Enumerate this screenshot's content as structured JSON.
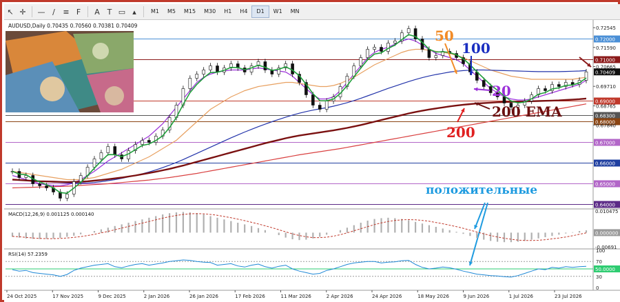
{
  "toolbar": {
    "timeframes": [
      {
        "label": "M1",
        "active": false
      },
      {
        "label": "M5",
        "active": false
      },
      {
        "label": "M15",
        "active": false
      },
      {
        "label": "M30",
        "active": false
      },
      {
        "label": "H1",
        "active": false
      },
      {
        "label": "H4",
        "active": false
      },
      {
        "label": "D1",
        "active": true
      },
      {
        "label": "W1",
        "active": false
      },
      {
        "label": "MN",
        "active": false
      }
    ],
    "tools": [
      "cursor-icon",
      "crosshair-icon",
      "horizontal-line-icon",
      "trendline-icon",
      "channel-icon",
      "fibonacci-icon",
      "text-icon",
      "label-icon",
      "rectangle-icon",
      "shapes-icon"
    ]
  },
  "chart_data": {
    "type": "line",
    "symbol_line": "AUDUSD,Daily  0.70435 0.70560 0.70381 0.70409",
    "x_dates": [
      "24 Oct 2025",
      "17 Nov 2025",
      "9 Dec 2025",
      "2 Jan 2026",
      "26 Jan 2026",
      "17 Feb 2026",
      "11 Mar 2026",
      "2 Apr 2026",
      "24 Apr 2026",
      "18 May 2026",
      "9 Jun 2026",
      "1 Jul 2026",
      "23 Jul 2026"
    ],
    "price_axis_ticks": [
      0.72545,
      0.7159,
      0.70665,
      0.6971,
      0.68765,
      0.6784
    ],
    "price_levels": [
      {
        "value": 0.72,
        "label": "0.72000",
        "color": "#4a8fd6"
      },
      {
        "value": 0.71,
        "label": "0.71000",
        "color": "#8b1a1a"
      },
      {
        "value": 0.69,
        "label": "0.69000",
        "color": "#c0392b"
      },
      {
        "value": 0.683,
        "label": "0.68300",
        "color": "#555555"
      },
      {
        "value": 0.68,
        "label": "0.68000",
        "color": "#8b4513"
      },
      {
        "value": 0.67,
        "label": "0.67000",
        "color": "#b266c8"
      },
      {
        "value": 0.66,
        "label": "0.66000",
        "color": "#1f3fa0"
      },
      {
        "value": 0.65,
        "label": "0.65000",
        "color": "#b266c8"
      },
      {
        "value": 0.64,
        "label": "0.64000",
        "color": "#5b2a86"
      }
    ],
    "current_price": {
      "value": 0.70409,
      "label": "0.70409"
    },
    "price_ylim": [
      0.6385,
      0.7285
    ],
    "closes": [
      0.656,
      0.653,
      0.654,
      0.65,
      0.649,
      0.648,
      0.646,
      0.643,
      0.645,
      0.651,
      0.654,
      0.658,
      0.662,
      0.665,
      0.668,
      0.664,
      0.662,
      0.666,
      0.669,
      0.671,
      0.67,
      0.673,
      0.676,
      0.682,
      0.688,
      0.696,
      0.701,
      0.703,
      0.705,
      0.707,
      0.704,
      0.706,
      0.708,
      0.706,
      0.704,
      0.707,
      0.709,
      0.705,
      0.703,
      0.706,
      0.708,
      0.703,
      0.699,
      0.693,
      0.688,
      0.686,
      0.69,
      0.692,
      0.697,
      0.702,
      0.707,
      0.711,
      0.715,
      0.716,
      0.714,
      0.718,
      0.719,
      0.723,
      0.725,
      0.72,
      0.715,
      0.711,
      0.712,
      0.714,
      0.713,
      0.711,
      0.708,
      0.704,
      0.7,
      0.697,
      0.694,
      0.692,
      0.689,
      0.687,
      0.688,
      0.69,
      0.693,
      0.696,
      0.695,
      0.698,
      0.697,
      0.699,
      0.698,
      0.7,
      0.7041
    ],
    "moving_averages": [
      {
        "label": "20",
        "color": "#9b30d9",
        "values": [
          0.654,
          0.653,
          0.652,
          0.651,
          0.65,
          0.6495,
          0.649,
          0.649,
          0.6495,
          0.6505,
          0.652,
          0.654,
          0.656,
          0.6585,
          0.661,
          0.663,
          0.665,
          0.667,
          0.669,
          0.671,
          0.673,
          0.676,
          0.679,
          0.683,
          0.687,
          0.691,
          0.695,
          0.699,
          0.7015,
          0.703,
          0.704,
          0.7045,
          0.705,
          0.705,
          0.705,
          0.7055,
          0.706,
          0.7055,
          0.705,
          0.7045,
          0.704,
          0.702,
          0.699,
          0.696,
          0.693,
          0.691,
          0.691,
          0.692,
          0.695,
          0.699,
          0.703,
          0.707,
          0.711,
          0.7135,
          0.715,
          0.716,
          0.7175,
          0.719,
          0.72,
          0.719,
          0.717,
          0.715,
          0.713,
          0.712,
          0.711,
          0.71,
          0.708,
          0.705,
          0.702,
          0.699,
          0.696,
          0.694,
          0.692,
          0.691,
          0.6905,
          0.6905,
          0.691,
          0.692,
          0.693,
          0.694,
          0.695,
          0.696,
          0.697,
          0.698,
          0.7
        ]
      },
      {
        "label": "50",
        "color": "#e8a060",
        "values": [
          0.656,
          0.6555,
          0.655,
          0.6545,
          0.654,
          0.6535,
          0.653,
          0.6525,
          0.652,
          0.652,
          0.652,
          0.6525,
          0.653,
          0.654,
          0.655,
          0.656,
          0.657,
          0.6585,
          0.66,
          0.6615,
          0.663,
          0.665,
          0.667,
          0.669,
          0.671,
          0.674,
          0.677,
          0.68,
          0.683,
          0.686,
          0.688,
          0.69,
          0.692,
          0.6935,
          0.695,
          0.696,
          0.697,
          0.6975,
          0.698,
          0.6985,
          0.699,
          0.699,
          0.6985,
          0.698,
          0.6975,
          0.697,
          0.697,
          0.6975,
          0.6985,
          0.7,
          0.7015,
          0.7035,
          0.7055,
          0.7075,
          0.709,
          0.7105,
          0.712,
          0.7135,
          0.7145,
          0.715,
          0.715,
          0.7145,
          0.714,
          0.7135,
          0.713,
          0.712,
          0.711,
          0.7095,
          0.708,
          0.7065,
          0.705,
          0.704,
          0.703,
          0.702,
          0.7015,
          0.701,
          0.7005,
          0.7005,
          0.7005,
          0.7005,
          0.7005,
          0.7005,
          0.7005,
          0.701,
          0.7015
        ]
      },
      {
        "label": "100",
        "color": "#2233aa",
        "values": [
          0.652,
          0.6518,
          0.6516,
          0.6514,
          0.6512,
          0.651,
          0.6508,
          0.6506,
          0.6504,
          0.6503,
          0.6503,
          0.6504,
          0.6506,
          0.651,
          0.6515,
          0.652,
          0.6526,
          0.6533,
          0.654,
          0.6548,
          0.6557,
          0.6567,
          0.6578,
          0.659,
          0.6603,
          0.6617,
          0.6632,
          0.6647,
          0.6662,
          0.6677,
          0.6692,
          0.6707,
          0.6722,
          0.6736,
          0.675,
          0.6763,
          0.6776,
          0.6788,
          0.68,
          0.6811,
          0.6822,
          0.6832,
          0.6841,
          0.6849,
          0.6856,
          0.6862,
          0.6868,
          0.6875,
          0.6883,
          0.6892,
          0.6902,
          0.6913,
          0.6925,
          0.6937,
          0.6949,
          0.6961,
          0.6972,
          0.6983,
          0.6994,
          0.7004,
          0.7013,
          0.7021,
          0.7028,
          0.7034,
          0.704,
          0.7044,
          0.7047,
          0.7049,
          0.705,
          0.705,
          0.7049,
          0.7048,
          0.7047,
          0.7046,
          0.7045,
          0.7044,
          0.7043,
          0.7042,
          0.7042,
          0.7042,
          0.7042,
          0.7043,
          0.7044,
          0.7045,
          0.7047
        ]
      },
      {
        "label": "200",
        "color": "#d94040",
        "values": [
          0.648,
          0.6481,
          0.6482,
          0.6483,
          0.6484,
          0.6485,
          0.6486,
          0.6487,
          0.6488,
          0.649,
          0.6492,
          0.6494,
          0.6496,
          0.6498,
          0.65,
          0.6503,
          0.6506,
          0.6509,
          0.6512,
          0.6515,
          0.6518,
          0.6522,
          0.6526,
          0.653,
          0.6535,
          0.654,
          0.6545,
          0.655,
          0.6556,
          0.6562,
          0.6568,
          0.6574,
          0.658,
          0.6586,
          0.6592,
          0.6598,
          0.6604,
          0.661,
          0.6616,
          0.6622,
          0.6628,
          0.6634,
          0.664,
          0.6645,
          0.665,
          0.6655,
          0.666,
          0.6665,
          0.667,
          0.6676,
          0.6682,
          0.6688,
          0.6694,
          0.67,
          0.6706,
          0.6712,
          0.6718,
          0.6724,
          0.673,
          0.6736,
          0.6742,
          0.6748,
          0.6754,
          0.676,
          0.6766,
          0.6772,
          0.6778,
          0.6784,
          0.679,
          0.6796,
          0.6802,
          0.6808,
          0.6814,
          0.682,
          0.6826,
          0.6832,
          0.6838,
          0.6844,
          0.685,
          0.6856,
          0.6862,
          0.6868,
          0.6874,
          0.688,
          0.6886
        ]
      },
      {
        "label": "200 EMA",
        "color": "#7a1010",
        "values": [
          0.652,
          0.6518,
          0.6516,
          0.6514,
          0.6512,
          0.6511,
          0.651,
          0.6509,
          0.6508,
          0.6509,
          0.651,
          0.6512,
          0.6515,
          0.6518,
          0.6522,
          0.6526,
          0.653,
          0.6535,
          0.654,
          0.6546,
          0.6552,
          0.6558,
          0.6565,
          0.6572,
          0.658,
          0.6588,
          0.6597,
          0.6606,
          0.6615,
          0.6624,
          0.6633,
          0.6642,
          0.6651,
          0.666,
          0.6669,
          0.6678,
          0.6687,
          0.6696,
          0.6704,
          0.6712,
          0.672,
          0.6727,
          0.6733,
          0.6738,
          0.6743,
          0.6748,
          0.6753,
          0.6758,
          0.6764,
          0.677,
          0.6777,
          0.6784,
          0.6792,
          0.68,
          0.6808,
          0.6816,
          0.6824,
          0.6832,
          0.684,
          0.6847,
          0.6853,
          0.6859,
          0.6864,
          0.6869,
          0.6874,
          0.6878,
          0.6882,
          0.6885,
          0.6888,
          0.689,
          0.6892,
          0.6894,
          0.6895,
          0.6896,
          0.6897,
          0.6898,
          0.6899,
          0.69,
          0.6901,
          0.6902,
          0.6903,
          0.6905,
          0.6907,
          0.6909,
          0.6912
        ]
      }
    ],
    "macd": {
      "label": "MACD(12,26,9) 0.001125 0.000140",
      "axis_ticks": [
        "0.010475",
        "0.000000",
        "-0.00691"
      ],
      "ylim": [
        -0.0072,
        0.0108
      ],
      "histogram": [
        -0.002,
        -0.0024,
        -0.0028,
        -0.003,
        -0.0031,
        -0.003,
        -0.0028,
        -0.0025,
        -0.002,
        -0.0015,
        -0.0008,
        0.0,
        0.0008,
        0.0016,
        0.0024,
        0.0032,
        0.004,
        0.0048,
        0.0056,
        0.0064,
        0.0072,
        0.008,
        0.0088,
        0.0094,
        0.0098,
        0.01,
        0.0098,
        0.0094,
        0.0088,
        0.008,
        0.0072,
        0.0064,
        0.0056,
        0.0048,
        0.004,
        0.0032,
        0.0022,
        0.0012,
        0.0,
        -0.0012,
        -0.0024,
        -0.0032,
        -0.0036,
        -0.0034,
        -0.0028,
        -0.002,
        -0.001,
        0.0,
        0.0012,
        0.0024,
        0.0036,
        0.0048,
        0.0058,
        0.0066,
        0.007,
        0.0072,
        0.007,
        0.0066,
        0.006,
        0.0052,
        0.0044,
        0.0036,
        0.0028,
        0.002,
        0.0012,
        0.0004,
        -0.0006,
        -0.0016,
        -0.0026,
        -0.0034,
        -0.004,
        -0.0044,
        -0.0046,
        -0.0046,
        -0.0044,
        -0.004,
        -0.0034,
        -0.0028,
        -0.0022,
        -0.0016,
        -0.001,
        -0.0004,
        0.0002,
        0.0008,
        0.0011
      ],
      "signal": [
        -0.0018,
        -0.002,
        -0.0023,
        -0.0026,
        -0.0028,
        -0.0029,
        -0.0029,
        -0.0028,
        -0.0026,
        -0.0023,
        -0.0019,
        -0.0014,
        -0.0008,
        -0.0001,
        0.0006,
        0.0014,
        0.0022,
        0.003,
        0.0038,
        0.0046,
        0.0054,
        0.0062,
        0.007,
        0.0077,
        0.0083,
        0.0088,
        0.0091,
        0.0092,
        0.0091,
        0.0088,
        0.0084,
        0.0078,
        0.0072,
        0.0065,
        0.0058,
        0.005,
        0.0042,
        0.0033,
        0.0024,
        0.0014,
        0.0004,
        -0.0006,
        -0.0014,
        -0.002,
        -0.0024,
        -0.0024,
        -0.0022,
        -0.0017,
        -0.001,
        -0.0001,
        0.0009,
        0.0019,
        0.0029,
        0.0039,
        0.0047,
        0.0054,
        0.0059,
        0.0062,
        0.0063,
        0.0062,
        0.0059,
        0.0055,
        0.0049,
        0.0043,
        0.0036,
        0.0029,
        0.0021,
        0.0012,
        0.0003,
        -0.0006,
        -0.0014,
        -0.0021,
        -0.0027,
        -0.0032,
        -0.0036,
        -0.0038,
        -0.0038,
        -0.0037,
        -0.0034,
        -0.003,
        -0.0026,
        -0.0021,
        -0.0015,
        -0.0008,
        -0.0001
      ]
    },
    "rsi": {
      "label": "RSI(14) 57.2359",
      "axis_ticks": [
        "100",
        "70",
        "50",
        "30",
        "0"
      ],
      "level_50_label": "50.0000",
      "values": [
        48,
        44,
        46,
        40,
        38,
        36,
        34,
        30,
        35,
        46,
        52,
        56,
        60,
        62,
        64,
        56,
        53,
        58,
        62,
        64,
        60,
        63,
        66,
        70,
        72,
        74,
        73,
        70,
        68,
        67,
        60,
        62,
        64,
        58,
        55,
        60,
        63,
        56,
        52,
        57,
        60,
        50,
        44,
        40,
        36,
        38,
        46,
        50,
        56,
        62,
        66,
        68,
        70,
        70,
        66,
        68,
        69,
        72,
        73,
        62,
        54,
        50,
        52,
        55,
        53,
        49,
        44,
        40,
        36,
        34,
        32,
        31,
        29,
        28,
        32,
        38,
        44,
        50,
        48,
        54,
        52,
        56,
        54,
        56,
        57
      ]
    },
    "annotations": [
      {
        "text": "50",
        "color": "#f28c28"
      },
      {
        "text": "100",
        "color": "#1a2ec0"
      },
      {
        "text": "20",
        "color": "#9b30d9"
      },
      {
        "text": "200 EMA",
        "color": "#6b0f0f"
      },
      {
        "text": "200",
        "color": "#e02020"
      },
      {
        "text": "положительные",
        "color": "#1e9be0"
      }
    ]
  }
}
